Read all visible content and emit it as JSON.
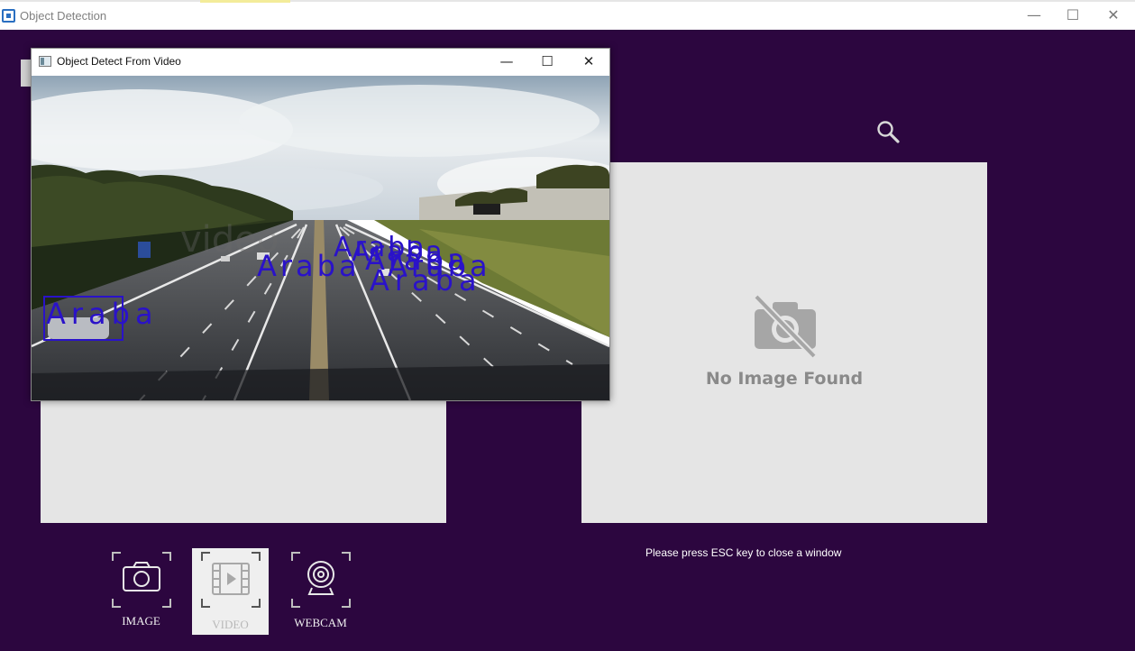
{
  "window": {
    "title": "Object Detection",
    "minimize": "—",
    "maximize": "☐",
    "close": "✕"
  },
  "video_window": {
    "title": "Object Detect From Video",
    "minimize": "—",
    "maximize": "☐",
    "close": "✕",
    "watermark": "video",
    "detections": [
      "Araba",
      "Araba",
      "Araba",
      "Araba",
      "Araba",
      "Araba",
      "Araba"
    ]
  },
  "preview": {
    "no_image_text": "No Image Found"
  },
  "status": {
    "esc_note": "Please press ESC key to close a window"
  },
  "modes": [
    {
      "label": "IMAGE",
      "icon": "camera-icon",
      "active": false
    },
    {
      "label": "VIDEO",
      "icon": "video-icon",
      "active": true
    },
    {
      "label": "WEBCAM",
      "icon": "webcam-icon",
      "active": false
    }
  ],
  "colors": {
    "background": "#2c063f",
    "panel": "#e5e5e5",
    "detection": "#2a12c9"
  }
}
